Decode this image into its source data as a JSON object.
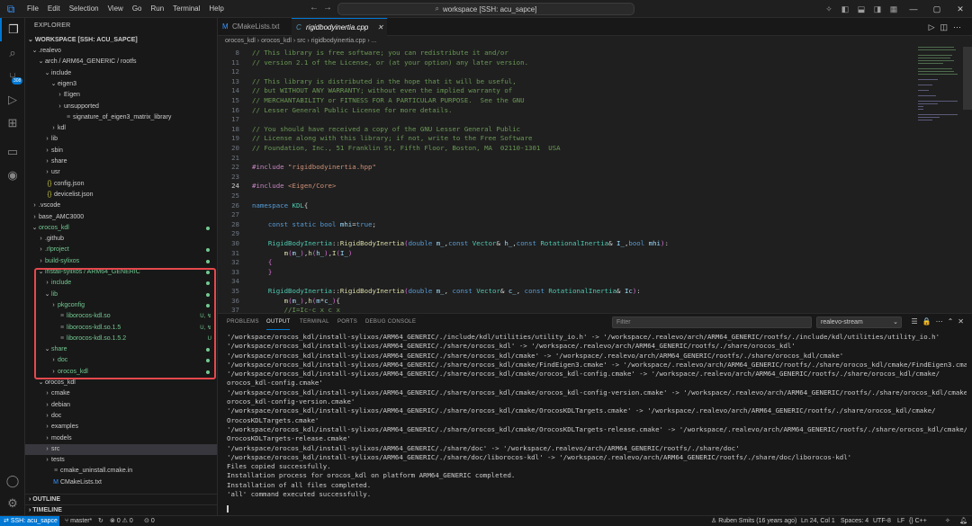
{
  "titlebar": {
    "menu": [
      "File",
      "Edit",
      "Selection",
      "View",
      "Go",
      "Run",
      "Terminal",
      "Help"
    ],
    "command_center": "workspace [SSH: acu_sapce]",
    "search_icon": "search-icon"
  },
  "activitybar": {
    "scm_badge": "308"
  },
  "sidebar": {
    "title": "EXPLORER",
    "workspace": "WORKSPACE [SSH: ACU_SAPCE]",
    "tree": [
      {
        "label": ".realevo",
        "depth": 0,
        "chev": "down",
        "icon": ""
      },
      {
        "label": "arch / ARM64_GENERIC / rootfs",
        "depth": 1,
        "chev": "down",
        "icon": ""
      },
      {
        "label": "include",
        "depth": 2,
        "chev": "down",
        "icon": ""
      },
      {
        "label": "eigen3",
        "depth": 3,
        "chev": "down",
        "icon": ""
      },
      {
        "label": "Eigen",
        "depth": 4,
        "chev": "right",
        "icon": ""
      },
      {
        "label": "unsupported",
        "depth": 4,
        "chev": "right",
        "icon": ""
      },
      {
        "label": "signature_of_eigen3_matrix_library",
        "depth": 4,
        "chev": "",
        "icon": "file"
      },
      {
        "label": "kdl",
        "depth": 3,
        "chev": "right",
        "icon": ""
      },
      {
        "label": "lib",
        "depth": 2,
        "chev": "right",
        "icon": ""
      },
      {
        "label": "sbin",
        "depth": 2,
        "chev": "right",
        "icon": ""
      },
      {
        "label": "share",
        "depth": 2,
        "chev": "right",
        "icon": ""
      },
      {
        "label": "usr",
        "depth": 2,
        "chev": "right",
        "icon": ""
      },
      {
        "label": "config.json",
        "depth": 1,
        "chev": "",
        "icon": "json"
      },
      {
        "label": "devicelist.json",
        "depth": 1,
        "chev": "",
        "icon": "json"
      },
      {
        "label": ".vscode",
        "depth": 0,
        "chev": "right",
        "icon": ""
      },
      {
        "label": "base_AMC3000",
        "depth": 0,
        "chev": "right",
        "icon": ""
      },
      {
        "label": "orocos_kdl",
        "depth": 0,
        "chev": "down",
        "icon": "",
        "color": "green",
        "dot": true
      },
      {
        "label": ".github",
        "depth": 1,
        "chev": "right",
        "icon": ""
      },
      {
        "label": ".rlproject",
        "depth": 1,
        "chev": "right",
        "icon": "",
        "color": "green",
        "dot": true
      },
      {
        "label": "build-sylixos",
        "depth": 1,
        "chev": "right",
        "icon": "",
        "color": "green",
        "dot": true
      },
      {
        "label": "install-sylixos / ARM64_GENERIC",
        "depth": 1,
        "chev": "down",
        "icon": "",
        "color": "green",
        "dot": true
      },
      {
        "label": "include",
        "depth": 2,
        "chev": "right",
        "icon": "",
        "color": "green",
        "dot": true
      },
      {
        "label": "lib",
        "depth": 2,
        "chev": "down",
        "icon": "",
        "color": "green",
        "dot": true
      },
      {
        "label": "pkgconfig",
        "depth": 3,
        "chev": "right",
        "icon": "",
        "color": "green",
        "dot": true
      },
      {
        "label": "liborocos-kdl.so",
        "depth": 3,
        "chev": "",
        "icon": "file",
        "color": "green",
        "status": "U, ↯"
      },
      {
        "label": "liborocos-kdl.so.1.5",
        "depth": 3,
        "chev": "",
        "icon": "file",
        "color": "green",
        "status": "U, ↯"
      },
      {
        "label": "liborocos-kdl.so.1.5.2",
        "depth": 3,
        "chev": "",
        "icon": "file",
        "color": "green",
        "status": "U"
      },
      {
        "label": "share",
        "depth": 2,
        "chev": "down",
        "icon": "",
        "color": "green",
        "dot": true
      },
      {
        "label": "doc",
        "depth": 3,
        "chev": "right",
        "icon": "",
        "color": "green",
        "dot": true
      },
      {
        "label": "orocos_kdl",
        "depth": 3,
        "chev": "right",
        "icon": "",
        "color": "green",
        "dot": true
      },
      {
        "label": "orocos_kdl",
        "depth": 1,
        "chev": "down",
        "icon": ""
      },
      {
        "label": "cmake",
        "depth": 2,
        "chev": "right",
        "icon": ""
      },
      {
        "label": "debian",
        "depth": 2,
        "chev": "right",
        "icon": ""
      },
      {
        "label": "doc",
        "depth": 2,
        "chev": "right",
        "icon": ""
      },
      {
        "label": "examples",
        "depth": 2,
        "chev": "right",
        "icon": ""
      },
      {
        "label": "models",
        "depth": 2,
        "chev": "right",
        "icon": ""
      },
      {
        "label": "src",
        "depth": 2,
        "chev": "right",
        "icon": "",
        "selected": true
      },
      {
        "label": "tests",
        "depth": 2,
        "chev": "right",
        "icon": ""
      },
      {
        "label": "cmake_uninstall.cmake.in",
        "depth": 2,
        "chev": "",
        "icon": "file"
      },
      {
        "label": "CMakeLists.txt",
        "depth": 2,
        "chev": "",
        "icon": "cmake"
      }
    ],
    "outline": "OUTLINE",
    "timeline": "TIMELINE"
  },
  "tabs": [
    {
      "label": "CMakeLists.txt",
      "active": false,
      "icon": "M"
    },
    {
      "label": "rigidbodyinertia.cpp",
      "active": true,
      "icon": "C"
    }
  ],
  "breadcrumb": "orocos_kdl  ›  orocos_kdl  ›  src  ›  rigidbodyinertia.cpp  ›  ...",
  "editor": {
    "lines": [
      {
        "n": "8",
        "segs": [
          [
            "cm",
            "// This library is free software; you can redistribute it and/or"
          ]
        ]
      },
      {
        "n": "11",
        "segs": [
          [
            "cm",
            "// version 2.1 of the License, or (at your option) any later version."
          ]
        ]
      },
      {
        "n": "12",
        "segs": [
          [
            "pl",
            ""
          ]
        ]
      },
      {
        "n": "13",
        "segs": [
          [
            "cm",
            "// This library is distributed in the hope that it will be useful,"
          ]
        ]
      },
      {
        "n": "14",
        "segs": [
          [
            "cm",
            "// but WITHOUT ANY WARRANTY; without even the implied warranty of"
          ]
        ]
      },
      {
        "n": "15",
        "segs": [
          [
            "cm",
            "// MERCHANTABILITY or FITNESS FOR A PARTICULAR PURPOSE.  See the GNU"
          ]
        ]
      },
      {
        "n": "16",
        "segs": [
          [
            "cm",
            "// Lesser General Public License for more details."
          ]
        ]
      },
      {
        "n": "17",
        "segs": [
          [
            "pl",
            ""
          ]
        ]
      },
      {
        "n": "18",
        "segs": [
          [
            "cm",
            "// You should have received a copy of the GNU Lesser General Public"
          ]
        ]
      },
      {
        "n": "19",
        "segs": [
          [
            "cm",
            "// License along with this library; if not, write to the Free Software"
          ]
        ]
      },
      {
        "n": "20",
        "segs": [
          [
            "cm",
            "// Foundation, Inc., 51 Franklin St, Fifth Floor, Boston, MA  02110-1301  USA"
          ]
        ]
      },
      {
        "n": "21",
        "segs": [
          [
            "pl",
            ""
          ]
        ]
      },
      {
        "n": "22",
        "segs": [
          [
            "pp",
            "#include "
          ],
          [
            "str",
            "\"rigidbodyinertia.hpp\""
          ]
        ]
      },
      {
        "n": "23",
        "segs": [
          [
            "pl",
            ""
          ]
        ]
      },
      {
        "n": "24",
        "segs": [
          [
            "pp",
            "#include "
          ],
          [
            "str",
            "<Eigen/Core>"
          ]
        ],
        "current": true
      },
      {
        "n": "25",
        "segs": [
          [
            "pl",
            ""
          ]
        ]
      },
      {
        "n": "26",
        "segs": [
          [
            "kw",
            "namespace "
          ],
          [
            "ty",
            "KDL"
          ],
          [
            "pl",
            "{"
          ]
        ]
      },
      {
        "n": "27",
        "segs": [
          [
            "pl",
            ""
          ]
        ]
      },
      {
        "n": "28",
        "segs": [
          [
            "pl",
            "    "
          ],
          [
            "kw",
            "const static bool "
          ],
          [
            "va",
            "mhi"
          ],
          [
            "pl",
            "="
          ],
          [
            "kw",
            "true"
          ],
          [
            "pl",
            ";"
          ]
        ]
      },
      {
        "n": "29",
        "segs": [
          [
            "pl",
            ""
          ]
        ]
      },
      {
        "n": "30",
        "segs": [
          [
            "pl",
            "    "
          ],
          [
            "ty",
            "RigidBodyInertia"
          ],
          [
            "pl",
            "::"
          ],
          [
            "fn",
            "RigidBodyInertia"
          ],
          [
            "br",
            "("
          ],
          [
            "kw",
            "double "
          ],
          [
            "va",
            "m_"
          ],
          [
            "pl",
            ","
          ],
          [
            "kw",
            "const "
          ],
          [
            "ty",
            "Vector"
          ],
          [
            "pl",
            "& "
          ],
          [
            "va",
            "h_"
          ],
          [
            "pl",
            ","
          ],
          [
            "kw",
            "const "
          ],
          [
            "ty",
            "RotationalInertia"
          ],
          [
            "pl",
            "& "
          ],
          [
            "va",
            "I_"
          ],
          [
            "pl",
            ","
          ],
          [
            "kw",
            "bool "
          ],
          [
            "va",
            "mhi"
          ],
          [
            "br",
            ")"
          ],
          [
            "pl",
            ":"
          ]
        ]
      },
      {
        "n": "31",
        "segs": [
          [
            "pl",
            "        "
          ],
          [
            "fn",
            "m"
          ],
          [
            "br",
            "("
          ],
          [
            "va",
            "m_"
          ],
          [
            "br",
            ")"
          ],
          [
            "pl",
            ","
          ],
          [
            "fn",
            "h"
          ],
          [
            "br",
            "("
          ],
          [
            "va",
            "h_"
          ],
          [
            "br",
            ")"
          ],
          [
            "pl",
            ","
          ],
          [
            "fn",
            "I"
          ],
          [
            "br",
            "("
          ],
          [
            "va",
            "I_"
          ],
          [
            "br",
            ")"
          ]
        ]
      },
      {
        "n": "32",
        "segs": [
          [
            "pl",
            "    "
          ],
          [
            "br",
            "{"
          ]
        ]
      },
      {
        "n": "33",
        "segs": [
          [
            "pl",
            "    "
          ],
          [
            "br",
            "}"
          ]
        ]
      },
      {
        "n": "34",
        "segs": [
          [
            "pl",
            ""
          ]
        ]
      },
      {
        "n": "35",
        "segs": [
          [
            "pl",
            "    "
          ],
          [
            "ty",
            "RigidBodyInertia"
          ],
          [
            "pl",
            "::"
          ],
          [
            "fn",
            "RigidBodyInertia"
          ],
          [
            "br",
            "("
          ],
          [
            "kw",
            "double "
          ],
          [
            "va",
            "m_"
          ],
          [
            "pl",
            ", "
          ],
          [
            "kw",
            "const "
          ],
          [
            "ty",
            "Vector"
          ],
          [
            "pl",
            "& "
          ],
          [
            "va",
            "c_"
          ],
          [
            "pl",
            ", "
          ],
          [
            "kw",
            "const "
          ],
          [
            "ty",
            "RotationalInertia"
          ],
          [
            "pl",
            "& "
          ],
          [
            "va",
            "Ic"
          ],
          [
            "br",
            ")"
          ],
          [
            "pl",
            ":"
          ]
        ]
      },
      {
        "n": "36",
        "segs": [
          [
            "pl",
            "        "
          ],
          [
            "fn",
            "m"
          ],
          [
            "br",
            "("
          ],
          [
            "va",
            "m_"
          ],
          [
            "br",
            ")"
          ],
          [
            "pl",
            ","
          ],
          [
            "fn",
            "h"
          ],
          [
            "br",
            "("
          ],
          [
            "va",
            "m"
          ],
          [
            "pl",
            "*"
          ],
          [
            "va",
            "c_"
          ],
          [
            "br",
            ")"
          ],
          [
            "pl",
            "{"
          ]
        ]
      },
      {
        "n": "37",
        "segs": [
          [
            "pl",
            "        "
          ],
          [
            "cm",
            "//I=Ic-c x c x"
          ]
        ]
      }
    ]
  },
  "panel": {
    "tabs": [
      "PROBLEMS",
      "OUTPUT",
      "TERMINAL",
      "PORTS",
      "DEBUG CONSOLE"
    ],
    "active_tab": "OUTPUT",
    "filter_placeholder": "Filter",
    "channel": "realevo-stream",
    "output": [
      "'/workspace/orocos_kdl/install-sylixos/ARM64_GENERIC/./include/kdl/utilities/utility_io.h' -> '/workspace/.realevo/arch/ARM64_GENERIC/rootfs/./include/kdl/utilities/utility_io.h'",
      "'/workspace/orocos_kdl/install-sylixos/ARM64_GENERIC/./share/orocos_kdl' -> '/workspace/.realevo/arch/ARM64_GENERIC/rootfs/./share/orocos_kdl'",
      "'/workspace/orocos_kdl/install-sylixos/ARM64_GENERIC/./share/orocos_kdl/cmake' -> '/workspace/.realevo/arch/ARM64_GENERIC/rootfs/./share/orocos_kdl/cmake'",
      "'/workspace/orocos_kdl/install-sylixos/ARM64_GENERIC/./share/orocos_kdl/cmake/FindEigen3.cmake' -> '/workspace/.realevo/arch/ARM64_GENERIC/rootfs/./share/orocos_kdl/cmake/FindEigen3.cmake'",
      "'/workspace/orocos_kdl/install-sylixos/ARM64_GENERIC/./share/orocos_kdl/cmake/orocos_kdl-config.cmake' -> '/workspace/.realevo/arch/ARM64_GENERIC/rootfs/./share/orocos_kdl/cmake/",
      "orocos_kdl-config.cmake'",
      "'/workspace/orocos_kdl/install-sylixos/ARM64_GENERIC/./share/orocos_kdl/cmake/orocos_kdl-config-version.cmake' -> '/workspace/.realevo/arch/ARM64_GENERIC/rootfs/./share/orocos_kdl/cmake/",
      "orocos_kdl-config-version.cmake'",
      "'/workspace/orocos_kdl/install-sylixos/ARM64_GENERIC/./share/orocos_kdl/cmake/OrocosKDLTargets.cmake' -> '/workspace/.realevo/arch/ARM64_GENERIC/rootfs/./share/orocos_kdl/cmake/",
      "OrocosKDLTargets.cmake'",
      "'/workspace/orocos_kdl/install-sylixos/ARM64_GENERIC/./share/orocos_kdl/cmake/OrocosKDLTargets-release.cmake' -> '/workspace/.realevo/arch/ARM64_GENERIC/rootfs/./share/orocos_kdl/cmake/",
      "OrocosKDLTargets-release.cmake'",
      "'/workspace/orocos_kdl/install-sylixos/ARM64_GENERIC/./share/doc' -> '/workspace/.realevo/arch/ARM64_GENERIC/rootfs/./share/doc'",
      "'/workspace/orocos_kdl/install-sylixos/ARM64_GENERIC/./share/doc/liborocos-kdl' -> '/workspace/.realevo/arch/ARM64_GENERIC/rootfs/./share/doc/liborocos-kdl'",
      "Files copied successfully.",
      "Installation process for orocos_kdl on platform ARM64_GENERIC completed.",
      "Installation of all files completed.",
      "'all' command executed successfully."
    ]
  },
  "statusbar": {
    "remote": "SSH: acu_sapce",
    "branch": "master*",
    "sync": "↻",
    "errors": "0",
    "warnings": "0",
    "ports": "0",
    "blame": "Ruben Smits (16 years ago)",
    "position": "Ln 24, Col 1",
    "spaces": "Spaces: 4",
    "encoding": "UTF-8",
    "eol": "LF",
    "language": "C++"
  },
  "colors": {
    "accent": "#0078d4",
    "git_untracked": "#73c991",
    "highlight_box": "#e5484d"
  }
}
